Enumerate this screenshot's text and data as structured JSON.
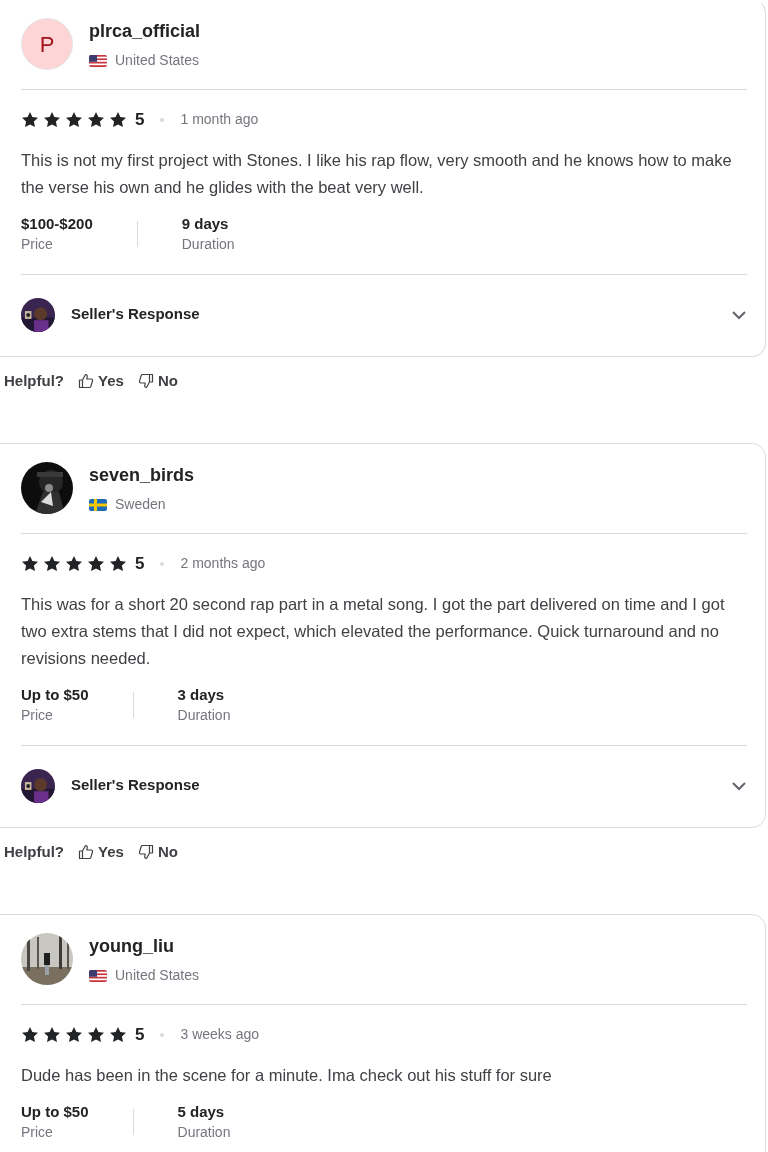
{
  "reviews": [
    {
      "username": "plrca_official",
      "avatar": {
        "kind": "letter",
        "letter": "P"
      },
      "flag": {
        "kind": "us"
      },
      "country": "United States",
      "stars": 5,
      "rating": "5",
      "time": "1 month ago",
      "text": "This is not my first project with Stones. I like his rap flow, very smooth and he knows how to make the verse his own and he glides with the beat very well.",
      "price": "$100-$200",
      "price_label": "Price",
      "duration": "9 days",
      "duration_label": "Duration",
      "seller_response": {
        "label": "Seller's Response",
        "expanded": false
      },
      "helpful": {
        "label": "Helpful?",
        "yes": "Yes",
        "no": "No"
      }
    },
    {
      "username": "seven_birds",
      "flag": {
        "kind": "se"
      },
      "country": "Sweden",
      "stars": 5,
      "rating": "5",
      "time": "2 months ago",
      "text": "This was for a short 20 second rap part in a metal song. I got the part delivered on time and I got two extra stems that I did not expect, which elevated the performance. Quick turnaround and no revisions needed.",
      "price": "Up to $50",
      "price_label": "Price",
      "duration": "3 days",
      "duration_label": "Duration",
      "seller_response": {
        "label": "Seller's Response",
        "expanded": false
      },
      "helpful": {
        "label": "Helpful?",
        "yes": "Yes",
        "no": "No"
      }
    },
    {
      "username": "young_liu",
      "flag": {
        "kind": "us"
      },
      "country": "United States",
      "stars": 5,
      "rating": "5",
      "time": "3 weeks ago",
      "text": "Dude has been in the scene for a minute. Ima check out his stuff for sure",
      "price": "Up to $50",
      "price_label": "Price",
      "duration": "5 days",
      "duration_label": "Duration"
    }
  ]
}
